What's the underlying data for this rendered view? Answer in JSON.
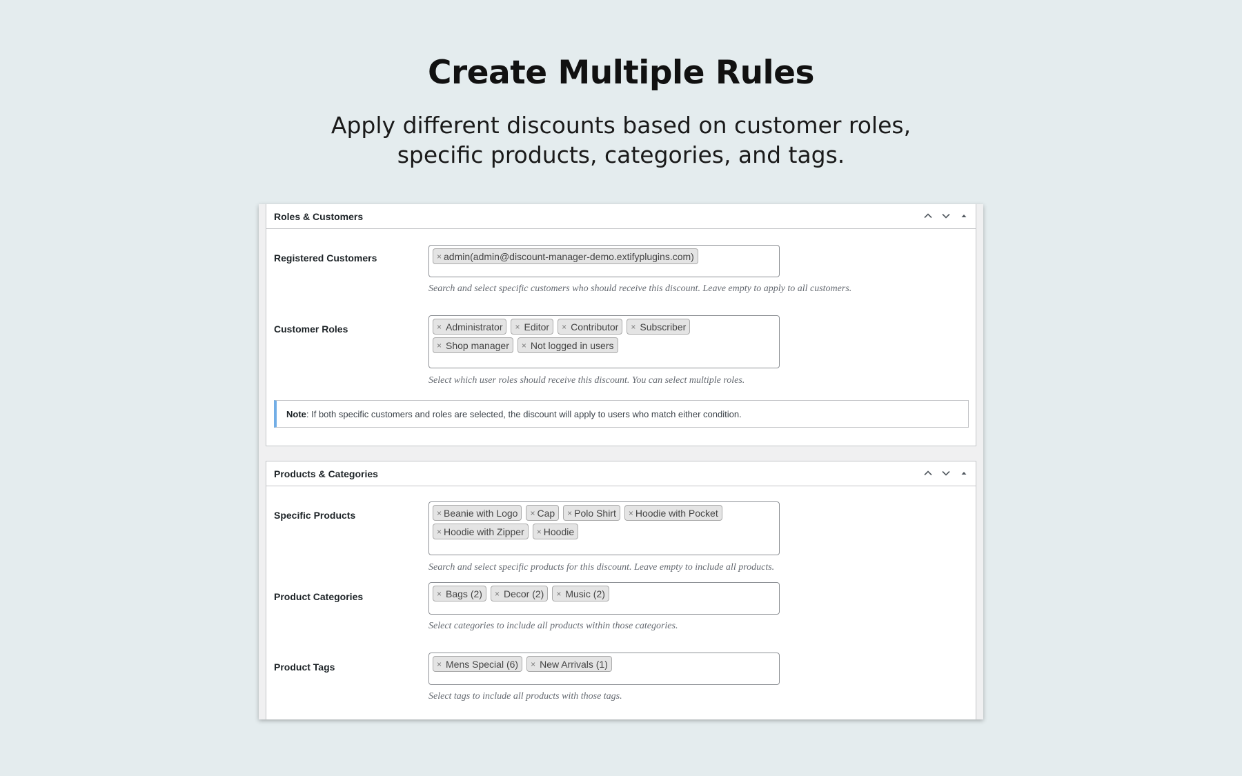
{
  "hero": {
    "title": "Create Multiple Rules",
    "subtitle_line1": "Apply different discounts based on customer roles,",
    "subtitle_line2": "specific products, categories, and tags."
  },
  "panels": [
    {
      "title": "Roles & Customers",
      "fields": [
        {
          "label": "Registered Customers",
          "chips": [
            "admin(admin@discount-manager-demo.extifyplugins.com)"
          ],
          "help": "Search and select specific customers who should receive this discount. Leave empty to apply to all customers."
        },
        {
          "label": "Customer Roles",
          "chips": [
            "Administrator",
            "Editor",
            "Contributor",
            "Subscriber",
            "Shop manager",
            "Not logged in users"
          ],
          "help": "Select which user roles should receive this discount. You can select multiple roles."
        }
      ],
      "note": {
        "bold": "Note",
        "text": ": If both specific customers and roles are selected, the discount will apply to users who match either condition."
      }
    },
    {
      "title": "Products & Categories",
      "fields": [
        {
          "label": "Specific Products",
          "chips": [
            "Beanie with Logo",
            "Cap",
            "Polo Shirt",
            "Hoodie with Pocket",
            "Hoodie with Zipper",
            "Hoodie"
          ],
          "help": "Search and select specific products for this discount. Leave empty to include all products."
        },
        {
          "label": "Product Categories",
          "chips": [
            "Bags (2)",
            "Decor (2)",
            "Music (2)"
          ],
          "help": "Select categories to include all products within those categories."
        },
        {
          "label": "Product Tags",
          "chips": [
            "Mens Special (6)",
            "New Arrivals (1)"
          ],
          "help": "Select tags to include all products with those tags."
        }
      ]
    }
  ],
  "icons": {
    "move_up": "chevron-up-icon",
    "move_down": "chevron-down-icon",
    "toggle": "triangle-up-icon",
    "remove_chip": "×"
  }
}
